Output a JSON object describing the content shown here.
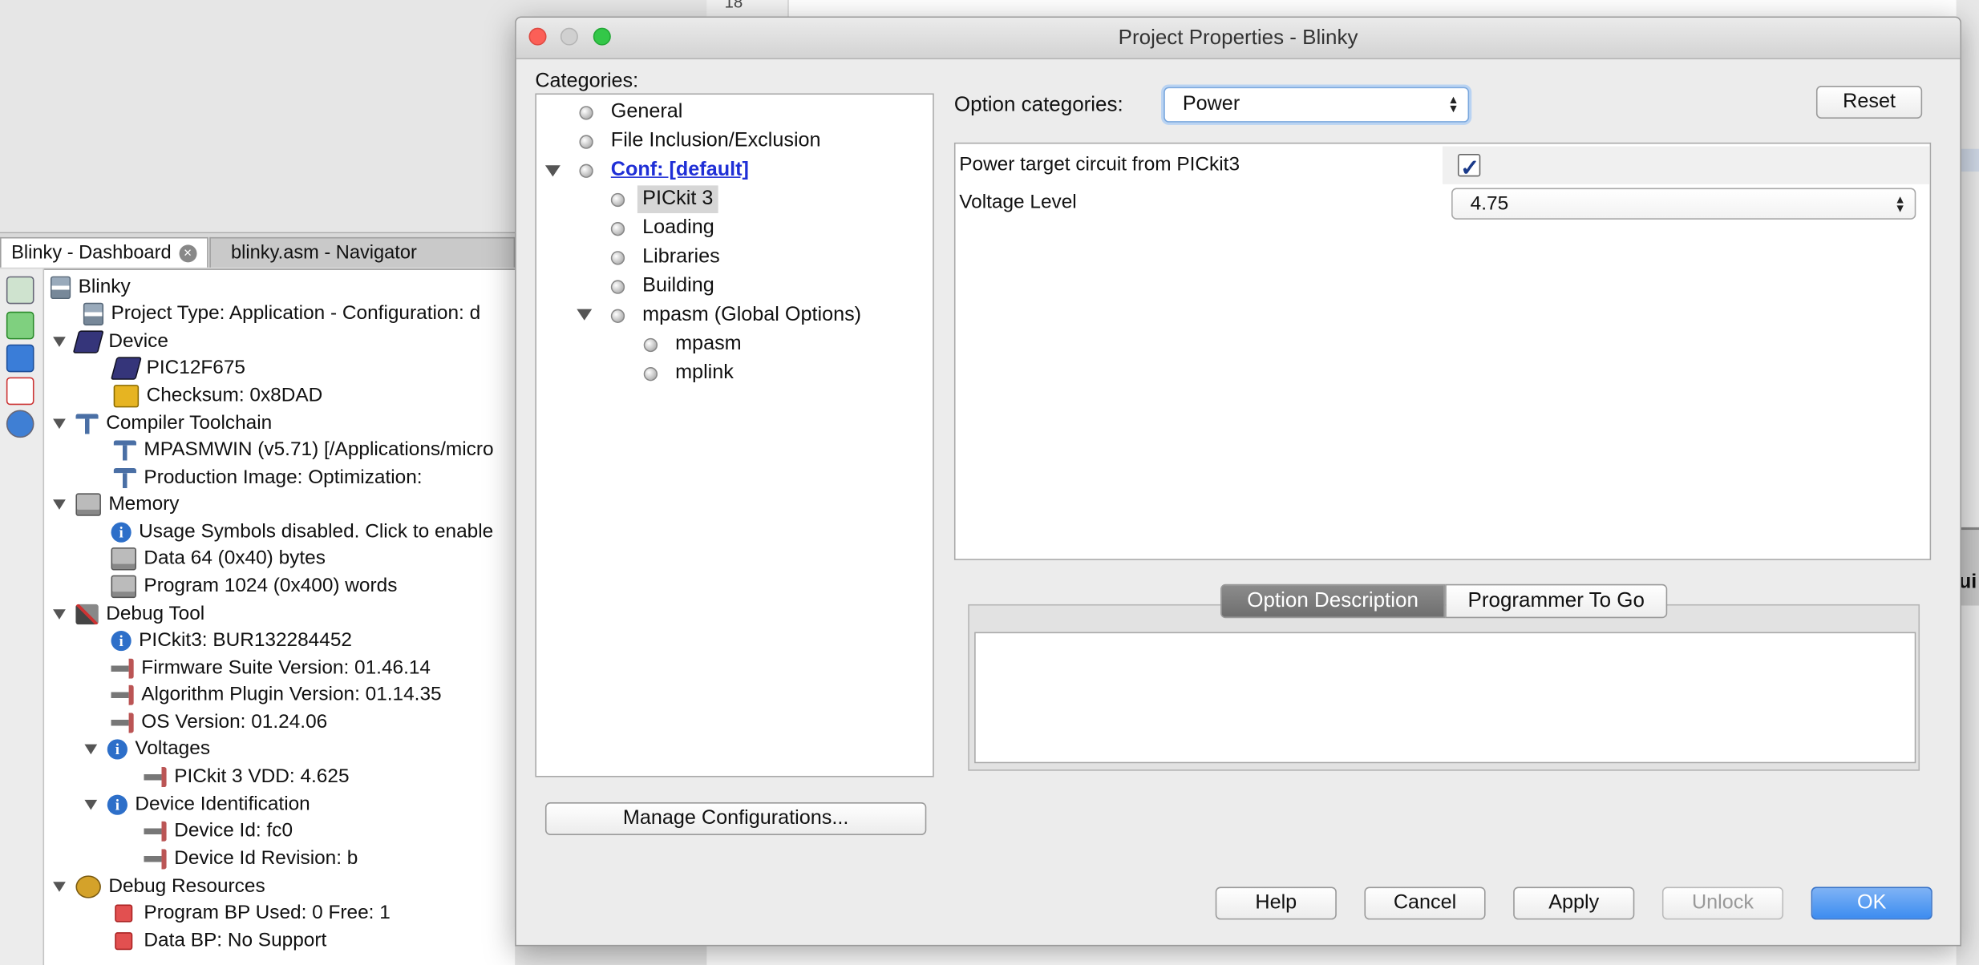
{
  "background": {
    "editor_line_number": "18",
    "right_panel_tab_text": "ui"
  },
  "dashboard": {
    "tabs": [
      {
        "label": "Blinky - Dashboard"
      },
      {
        "label": "blinky.asm - Navigator"
      }
    ],
    "toolbar_icons": [
      "refresh-icon",
      "reload-icon",
      "chip-icon",
      "pdf-icon",
      "help-icon"
    ],
    "tree": [
      {
        "text": "Blinky",
        "icon": "project-icon"
      },
      {
        "text": "Project Type: Application - Configuration: d",
        "icon": "project-icon"
      },
      {
        "text": "Device",
        "icon": "chip-icon"
      },
      {
        "text": "PIC12F675",
        "icon": "chip-icon"
      },
      {
        "text": "Checksum: 0x8DAD",
        "icon": "checksum-icon"
      },
      {
        "text": "Compiler Toolchain",
        "icon": "hammer-icon"
      },
      {
        "text": "MPASMWIN (v5.71) [/Applications/micro",
        "icon": "hammer-icon"
      },
      {
        "text": "Production Image: Optimization:",
        "icon": "hammer-icon"
      },
      {
        "text": "Memory",
        "icon": "memory-icon"
      },
      {
        "text": "Usage Symbols disabled. Click to enable",
        "icon": "info-icon"
      },
      {
        "text": "Data 64 (0x40) bytes",
        "icon": "memory-icon"
      },
      {
        "text": "Program 1024 (0x400) words",
        "icon": "memory-icon"
      },
      {
        "text": "Debug Tool",
        "icon": "tools-icon"
      },
      {
        "text": "PICkit3: BUR132284452",
        "icon": "info-icon"
      },
      {
        "text": "Firmware Suite Version: 01.46.14",
        "icon": "plug-icon"
      },
      {
        "text": "Algorithm Plugin Version: 01.14.35",
        "icon": "plug-icon"
      },
      {
        "text": "OS Version: 01.24.06",
        "icon": "plug-icon"
      },
      {
        "text": "Voltages",
        "icon": "info-icon"
      },
      {
        "text": "PICkit 3 VDD: 4.625",
        "icon": "plug-icon"
      },
      {
        "text": "Device Identification",
        "icon": "info-icon"
      },
      {
        "text": "Device Id: fc0",
        "icon": "plug-icon"
      },
      {
        "text": "Device Id Revision: b",
        "icon": "plug-icon"
      },
      {
        "text": "Debug Resources",
        "icon": "bug-icon"
      },
      {
        "text": "Program BP Used: 0  Free: 1",
        "icon": "breakpoint-icon"
      },
      {
        "text": "Data BP: No Support",
        "icon": "breakpoint-icon"
      }
    ]
  },
  "dialog": {
    "title": "Project Properties - Blinky",
    "categories_label": "Categories:",
    "categories": [
      {
        "label": "General"
      },
      {
        "label": "File Inclusion/Exclusion"
      },
      {
        "label": "Conf: [default]"
      },
      {
        "label": "PICkit 3"
      },
      {
        "label": "Loading"
      },
      {
        "label": "Libraries"
      },
      {
        "label": "Building"
      },
      {
        "label": "mpasm (Global Options)"
      },
      {
        "label": "mpasm"
      },
      {
        "label": "mplink"
      }
    ],
    "selected_category": "PICkit 3",
    "manage_configurations_label": "Manage Configurations...",
    "option_categories_label": "Option categories:",
    "option_category_value": "Power",
    "reset_label": "Reset",
    "properties": {
      "power_target_label": "Power target circuit from PICkit3",
      "power_target_checked": true,
      "voltage_level_label": "Voltage Level",
      "voltage_level_value": "4.75"
    },
    "tabs": {
      "option_description": "Option Description",
      "programmer_to_go": "Programmer To Go",
      "active": "Option Description"
    },
    "description_text": "",
    "buttons": {
      "help": "Help",
      "cancel": "Cancel",
      "apply": "Apply",
      "unlock": "Unlock",
      "ok": "OK"
    }
  },
  "colors": {
    "link": "#1f2fd6",
    "default_button": "#3c8cf0",
    "close_light": "#fc5f57",
    "zoom_light": "#33c748"
  }
}
